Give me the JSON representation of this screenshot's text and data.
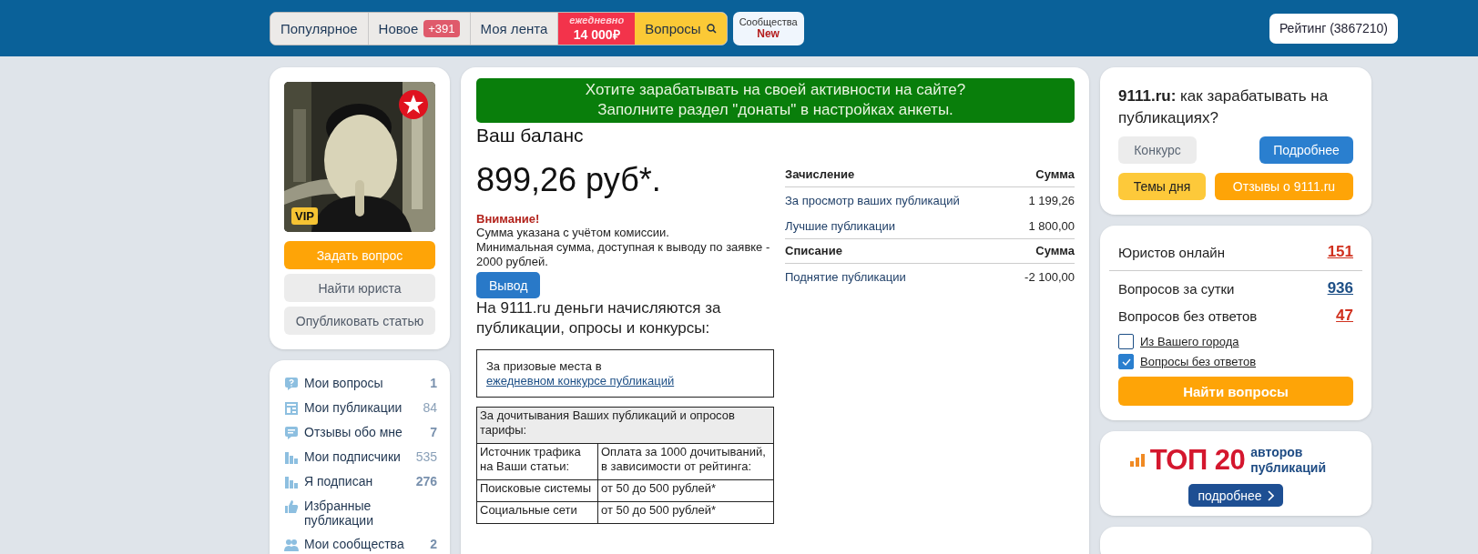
{
  "nav": {
    "tabs": [
      {
        "kind": "plain",
        "label": "Популярное"
      },
      {
        "kind": "plain",
        "label": "Новое",
        "badge": "+391"
      },
      {
        "kind": "plain",
        "label": "Моя лента"
      },
      {
        "kind": "promo",
        "label": "ежедневно",
        "amount": "14 000₽"
      },
      {
        "kind": "search",
        "label": "Вопросы"
      }
    ],
    "communities": {
      "label": "Сообщества",
      "badge": "New"
    },
    "rating": "Рейтинг (3867210)"
  },
  "profile": {
    "badge": "VIP",
    "buttons": [
      {
        "kind": "primary",
        "label": "Задать вопрос"
      },
      {
        "kind": "secondary",
        "label": "Найти юриста"
      },
      {
        "kind": "secondary",
        "label": "Опубликовать статью"
      }
    ]
  },
  "menu": [
    {
      "label": "Мои вопросы",
      "count": "1",
      "bold": true
    },
    {
      "label": "Мои публикации",
      "count": "84",
      "bold": false
    },
    {
      "label": "Отзывы обо мне",
      "count": "7",
      "bold": true
    },
    {
      "label": "Мои подписчики",
      "count": "535",
      "bold": false
    },
    {
      "label": "Я подписан",
      "count": "276",
      "bold": true
    },
    {
      "label": "Избранные публикации"
    },
    {
      "label": "Мои сообщества",
      "count": "2",
      "bold": true
    }
  ],
  "banner": [
    "Хотите зарабатывать на своей активности на сайте?",
    "Заполните раздел \"донаты\" в настройках анкеты."
  ],
  "balance": {
    "title": "Ваш баланс",
    "amount": "899,26 руб*.",
    "warning": "Внимание!",
    "note": [
      "Сумма указана с учётом комиссии.",
      "Минимальная сумма, доступная к выводу по заявке - 2000 рублей."
    ],
    "button": "Вывод",
    "info": "На 9111.ru деньги начисляются за публикации, опросы и конкурсы:",
    "prize": {
      "text": "За призовые места в",
      "link": "ежедневном конкурсе публикаций"
    },
    "tariffs": {
      "header": "За дочитывания Ваших публикаций и опросов тарифы:",
      "rows": [
        [
          "Источник трафика на Ваши статьи:",
          "Оплата за 1000 дочитываний, в зависимости от рейтинга:"
        ],
        [
          "Поисковые системы",
          "от 50 до 500 рублей*"
        ],
        [
          "Социальные сети",
          "от 50 до 500 рублей*"
        ]
      ]
    }
  },
  "ledger": [
    {
      "heading": "Зачисление",
      "sum_heading": "Сумма",
      "rows": [
        {
          "label": "За просмотр ваших публикаций",
          "amount": "1 199,26"
        },
        {
          "label": "Лучшие публикации",
          "amount": "1 800,00"
        }
      ]
    },
    {
      "heading": "Списание",
      "sum_heading": "Сумма",
      "rows": [
        {
          "label": "Поднятие публикации",
          "amount": "-2 100,00"
        }
      ]
    }
  ],
  "earn": {
    "title": "**9111.ru:** как зарабатывать на публикациях?",
    "buttons": [
      {
        "kind": "grey",
        "label": "Конкурс"
      },
      {
        "kind": "blue",
        "label": "Подробнее"
      },
      {
        "kind": "yellow",
        "label": "Темы дня"
      },
      {
        "kind": "orange",
        "label": "Отзывы о 9111.ru"
      }
    ]
  },
  "stats": {
    "items": [
      {
        "label": "Юристов онлайн",
        "value": "151",
        "color": "#d0301e"
      },
      {
        "label": "Вопросов за сутки",
        "value": "936",
        "color": "#1d4f86"
      },
      {
        "label": "Вопросов без ответов",
        "value": "47",
        "color": "#d0301e"
      }
    ],
    "filters": [
      {
        "label": "Из Вашего города",
        "checked": false
      },
      {
        "label": "Вопросы без ответов",
        "checked": true
      }
    ],
    "button": "Найти вопросы"
  },
  "top": {
    "title": "ТОП 20",
    "subtitle": "авторов публикаций",
    "button": "подробнее"
  }
}
